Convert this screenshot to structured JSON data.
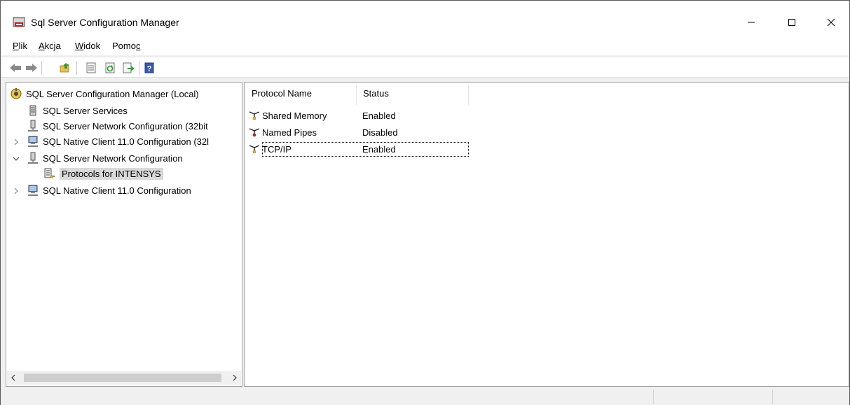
{
  "window": {
    "title": "Sql Server Configuration Manager"
  },
  "menu": {
    "items": [
      {
        "label": "Plik",
        "accel": "P"
      },
      {
        "label": "Akcja",
        "accel": "A"
      },
      {
        "label": "Widok",
        "accel": "W"
      },
      {
        "label": "Pomoc",
        "accel": "c"
      }
    ]
  },
  "toolbar": {
    "buttons": [
      "back-arrow-icon",
      "forward-arrow-icon",
      "up-folder-icon",
      "properties-icon",
      "refresh-icon",
      "export-list-icon",
      "help-icon"
    ]
  },
  "tree": {
    "root": "SQL Server Configuration Manager (Local)",
    "items": [
      {
        "label": "SQL Server Services"
      },
      {
        "label": "SQL Server Network Configuration (32bit"
      },
      {
        "label": "SQL Native Client 11.0 Configuration (32l"
      },
      {
        "label": "SQL Server Network Configuration"
      },
      {
        "label": "Protocols for INTENSYS"
      },
      {
        "label": "SQL Native Client 11.0 Configuration"
      }
    ]
  },
  "list": {
    "columns": [
      "Protocol Name",
      "Status"
    ],
    "rows": [
      {
        "name": "Shared Memory",
        "status": "Enabled"
      },
      {
        "name": "Named Pipes",
        "status": "Disabled"
      },
      {
        "name": "TCP/IP",
        "status": "Enabled"
      }
    ]
  },
  "colors": {
    "selection": "#d9d9d9",
    "border": "#a0a0a0"
  }
}
